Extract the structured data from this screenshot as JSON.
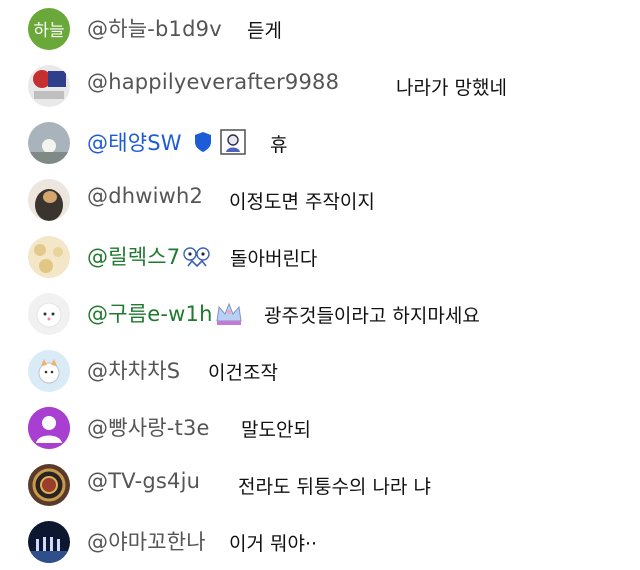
{
  "chat": {
    "messages": [
      {
        "avatar_text": "하늘",
        "avatar_color": "#6aa83a",
        "author": "@하늘-b1d9v",
        "message": "듣게"
      },
      {
        "author": "@happilyeverafter9988",
        "message": "나라가 망했네"
      },
      {
        "author": "@태양SW",
        "author_color": "#1e5bd6",
        "message": "휴",
        "badges": [
          "shield-icon",
          "member-badge-icon"
        ]
      },
      {
        "author": "@dhwiwh2",
        "message": "이정도면 주작이지"
      },
      {
        "author": "@릴렉스7",
        "author_color": "#1f7a2f",
        "message": "돌아버린다",
        "badges": [
          "member-badge-icon"
        ]
      },
      {
        "author": "@구름e-w1h",
        "author_color": "#1f7a2f",
        "message": "광주것들이라고 하지마세요",
        "badges": [
          "crown-badge-icon"
        ]
      },
      {
        "author": "@차차차S",
        "message": "이건조작"
      },
      {
        "author": "@빵사랑-t3e",
        "message": "말도안되",
        "avatar_color": "#a93fd1"
      },
      {
        "author": "@TV-gs4ju",
        "message": "전라도 뒤퉁수의 나라 냐"
      },
      {
        "author": "@야마꼬한나",
        "message": "이거 뭐야··"
      }
    ]
  }
}
